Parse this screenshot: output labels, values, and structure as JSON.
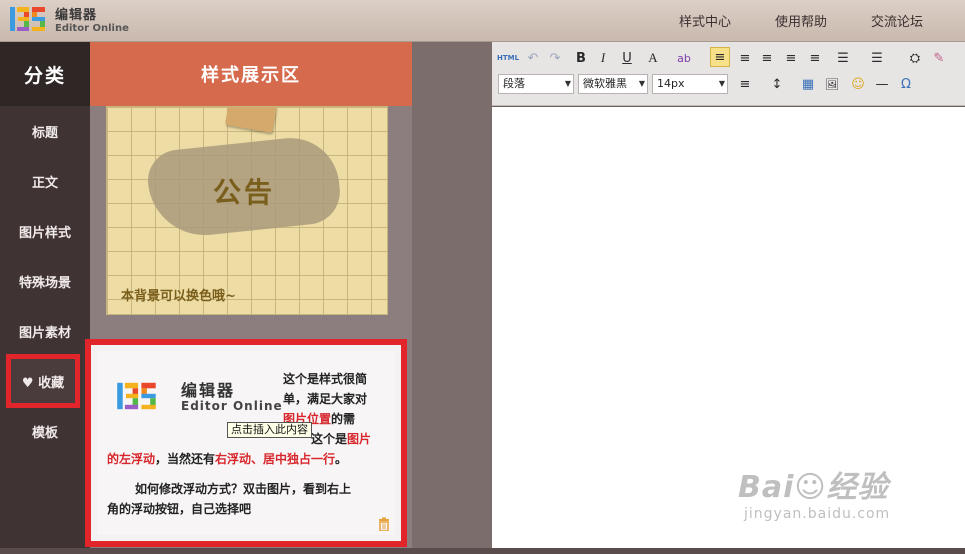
{
  "app": {
    "logo_cn": "编辑器",
    "logo_en": "Editor Online"
  },
  "topnav": [
    {
      "label": "样式中心"
    },
    {
      "label": "使用帮助"
    },
    {
      "label": "交流论坛"
    }
  ],
  "sidebar": {
    "title": "分类",
    "items": [
      {
        "label": "标题"
      },
      {
        "label": "正文"
      },
      {
        "label": "图片样式"
      },
      {
        "label": "特殊场景"
      },
      {
        "label": "图片素材"
      },
      {
        "label": "♥ 收藏"
      },
      {
        "label": "模板"
      }
    ],
    "active_index": 5
  },
  "panel": {
    "title": "样式展示区",
    "notice": {
      "title": "公告",
      "caption": "本背景可以换色哦~"
    },
    "favorite": {
      "logo_cn": "编辑器",
      "logo_en": "Editor Online",
      "right_text": [
        "这个是样式很简",
        "单，满足大家对"
      ],
      "red_1": "图片位置",
      "after_red_1": "的需",
      "line4_mid": "这个是",
      "red_2": "图片",
      "red_3": "的左浮动",
      "mid_5": "，当然还有",
      "red_4": "右浮动、居中独占一行",
      "end_5": "。",
      "para_2_line_1": "如何修改浮动方式？双击图片，看到右上",
      "para_2_line_2": "角的浮动按钮，自己选择吧",
      "tooltip": "点击插入此内容"
    }
  },
  "toolbar": {
    "row1": [
      "HTML",
      "↶",
      "↷",
      "B",
      "I",
      "U",
      "A",
      "ab",
      "≡",
      "≡",
      "≡",
      "≡",
      "≡",
      "☰",
      "☰",
      "⛭",
      "✎"
    ],
    "selects": [
      {
        "value": "段落"
      },
      {
        "value": "微软雅黑"
      },
      {
        "value": "14px"
      }
    ],
    "row2_icons": [
      "≡",
      "↕",
      "▦",
      "🖼",
      "☺",
      "—",
      "Ω"
    ]
  },
  "watermark": {
    "line1": "Bai☺经验",
    "line2": "jingyan.baidu.com"
  },
  "colors": {
    "accent_red": "#e2252b",
    "panel_header": "#d66a4d",
    "sidebar_bg": "#3f3333"
  }
}
